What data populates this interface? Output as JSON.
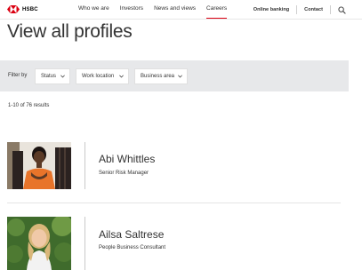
{
  "header": {
    "brand": "HSBC",
    "nav": [
      "Who we are",
      "Investors",
      "News and views",
      "Careers"
    ],
    "active_nav": "Careers",
    "online_banking": "Online banking",
    "contact": "Contact"
  },
  "page": {
    "title": "View all profiles"
  },
  "filters": {
    "label": "Filter by",
    "status": "Status",
    "work_location": "Work location",
    "business_area": "Business area"
  },
  "results_text": "1-10 of 76 results",
  "profiles": [
    {
      "name": "Abi Whittles",
      "role": "Senior Risk Manager"
    },
    {
      "name": "Ailsa Saltrese",
      "role": "People Business Consultant"
    }
  ],
  "colors": {
    "brand_red": "#db0011",
    "filter_bar": "#e7e8ea",
    "text": "#333333"
  },
  "icons": [
    "hsbc-logo-icon",
    "search-icon",
    "chevron-down-icon"
  ]
}
